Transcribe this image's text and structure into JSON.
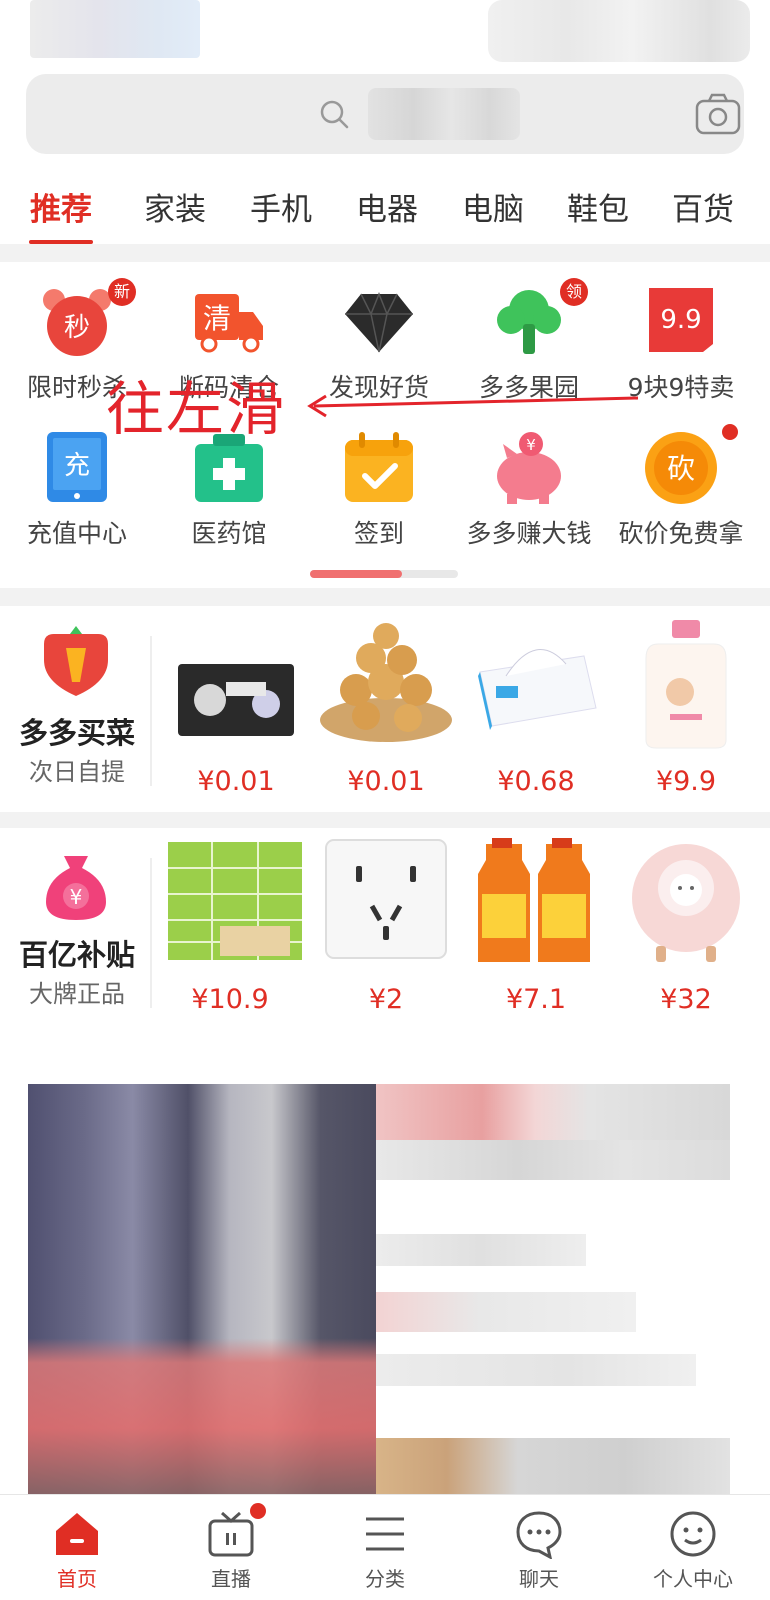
{
  "tabs": [
    "推荐",
    "家装",
    "手机",
    "电器",
    "电脑",
    "鞋包",
    "百货"
  ],
  "grid": {
    "items": [
      {
        "label": "限时秒杀",
        "icon": "alarm-clock-icon",
        "icon_text": "秒",
        "badge": "新"
      },
      {
        "label": "断码清仓",
        "icon": "delivery-truck-icon",
        "icon_text": "清"
      },
      {
        "label": "发现好货",
        "icon": "diamond-icon"
      },
      {
        "label": "多多果园",
        "icon": "tree-icon",
        "badge": "领"
      },
      {
        "label": "9块9特卖",
        "icon": "price-tag-icon",
        "icon_text": "9.9"
      },
      {
        "label": "充值中心",
        "icon": "tablet-recharge-icon",
        "icon_text": "充"
      },
      {
        "label": "医药馆",
        "icon": "medicine-box-icon"
      },
      {
        "label": "签到",
        "icon": "calendar-check-icon"
      },
      {
        "label": "多多赚大钱",
        "icon": "piggy-bank-icon"
      },
      {
        "label": "砍价免费拿",
        "icon": "bargain-coin-icon",
        "icon_text": "砍"
      }
    ],
    "scroll_progress": 0.62
  },
  "annotation": {
    "text": "往左滑"
  },
  "rows": [
    {
      "brand_title": "多多买菜",
      "brand_sub": "次日自提",
      "brand_icon": "carrot-icon",
      "products": [
        {
          "price": "¥0.01",
          "icon": "cotton-pads-image"
        },
        {
          "price": "¥0.01",
          "icon": "cookies-basket-image"
        },
        {
          "price": "¥0.68",
          "icon": "tissue-box-image"
        },
        {
          "price": "¥9.9",
          "icon": "detergent-bottle-image"
        }
      ]
    },
    {
      "brand_title": "百亿补贴",
      "brand_sub": "大牌正品",
      "brand_icon": "money-bag-icon",
      "products": [
        {
          "price": "¥10.9",
          "icon": "tissue-packs-image"
        },
        {
          "price": "¥2",
          "icon": "wall-socket-image"
        },
        {
          "price": "¥7.1",
          "icon": "cleaner-bottles-image"
        },
        {
          "price": "¥32",
          "icon": "humidifier-image"
        }
      ]
    }
  ],
  "nav": [
    {
      "label": "首页",
      "icon": "home-icon",
      "active": true
    },
    {
      "label": "直播",
      "icon": "tv-icon",
      "dot": true
    },
    {
      "label": "分类",
      "icon": "list-icon"
    },
    {
      "label": "聊天",
      "icon": "chat-bubble-icon"
    },
    {
      "label": "个人中心",
      "icon": "profile-face-icon"
    }
  ],
  "colors": {
    "accent": "#e02e24",
    "bg": "#f2f2f2"
  }
}
